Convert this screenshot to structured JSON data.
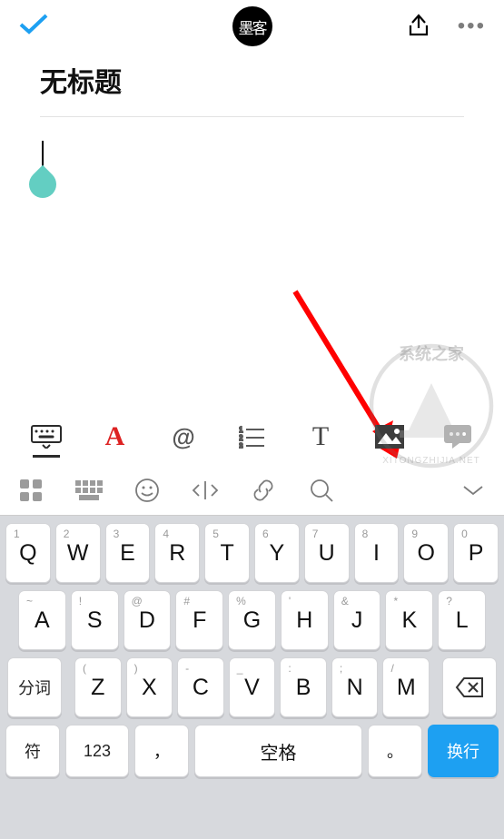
{
  "app": {
    "logo_text": "墨客"
  },
  "doc": {
    "title": "无标题"
  },
  "format_toolbar": {
    "font_style": "A",
    "mention": "@",
    "serif_t": "T"
  },
  "keyboard": {
    "row1": [
      {
        "main": "Q",
        "sup": "1"
      },
      {
        "main": "W",
        "sup": "2"
      },
      {
        "main": "E",
        "sup": "3"
      },
      {
        "main": "R",
        "sup": "4"
      },
      {
        "main": "T",
        "sup": "5"
      },
      {
        "main": "Y",
        "sup": "6"
      },
      {
        "main": "U",
        "sup": "7"
      },
      {
        "main": "I",
        "sup": "8"
      },
      {
        "main": "O",
        "sup": "9"
      },
      {
        "main": "P",
        "sup": "0"
      }
    ],
    "row2": [
      {
        "main": "A",
        "sup": "~"
      },
      {
        "main": "S",
        "sup": "!"
      },
      {
        "main": "D",
        "sup": "@"
      },
      {
        "main": "F",
        "sup": "#"
      },
      {
        "main": "G",
        "sup": "%"
      },
      {
        "main": "H",
        "sup": "'"
      },
      {
        "main": "J",
        "sup": "&"
      },
      {
        "main": "K",
        "sup": "*"
      },
      {
        "main": "L",
        "sup": "?"
      }
    ],
    "row3_letters": [
      {
        "main": "Z",
        "sup": "("
      },
      {
        "main": "X",
        "sup": ")"
      },
      {
        "main": "C",
        "sup": "-"
      },
      {
        "main": "V",
        "sup": "_"
      },
      {
        "main": "B",
        "sup": ":"
      },
      {
        "main": "N",
        "sup": ";"
      },
      {
        "main": "M",
        "sup": "/"
      }
    ],
    "segment_key": "分词",
    "symbols_key": "符",
    "numeric_key": "123",
    "comma_key": "，",
    "space_key": "空格",
    "period_key": "。",
    "enter_key": "换行"
  },
  "watermark": {
    "chinese": "系统之家",
    "pinyin": "XITONGZHIJIA.NET"
  }
}
